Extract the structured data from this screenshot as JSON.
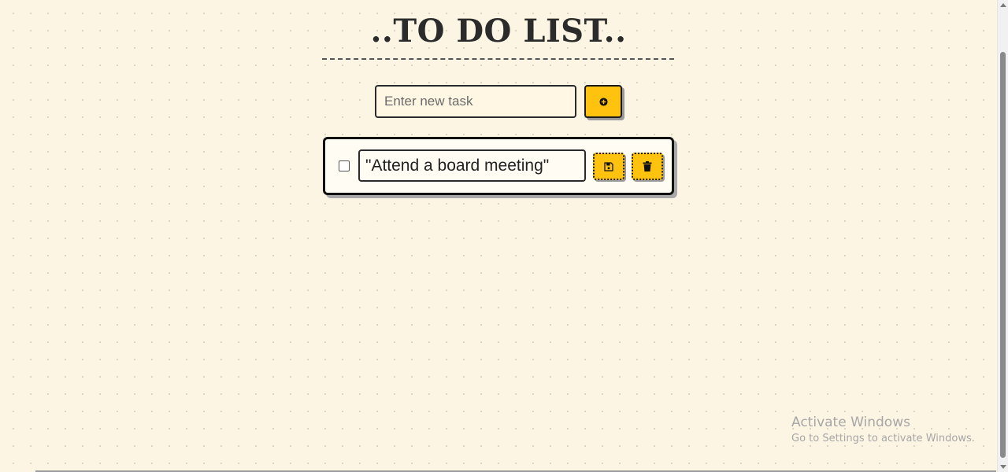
{
  "header": {
    "title": "..TO DO LIST.."
  },
  "new_task": {
    "placeholder": "Enter new task",
    "add_icon": "plus-circle-icon"
  },
  "tasks": [
    {
      "text": "\"Attend a board meeting\"",
      "completed": false,
      "save_icon": "floppy-disk-icon",
      "delete_icon": "trash-icon"
    }
  ],
  "watermark": {
    "title": "Activate Windows",
    "subtitle": "Go to Settings to activate Windows."
  },
  "colors": {
    "background": "#fdf5e4",
    "accent": "#ffc20e",
    "border": "#111111"
  }
}
